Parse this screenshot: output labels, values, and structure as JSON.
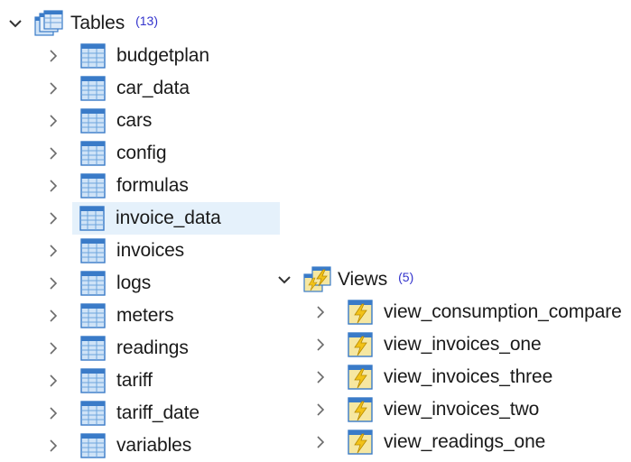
{
  "tables": {
    "label": "Tables",
    "count": "(13)",
    "items": [
      {
        "label": "budgetplan"
      },
      {
        "label": "car_data"
      },
      {
        "label": "cars"
      },
      {
        "label": "config"
      },
      {
        "label": "formulas"
      },
      {
        "label": "invoice_data",
        "hovered": true
      },
      {
        "label": "invoices"
      },
      {
        "label": "logs"
      },
      {
        "label": "meters"
      },
      {
        "label": "readings"
      },
      {
        "label": "tariff"
      },
      {
        "label": "tariff_date"
      },
      {
        "label": "variables"
      }
    ]
  },
  "views": {
    "label": "Views",
    "count": "(5)",
    "items": [
      {
        "label": "view_consumption_compare"
      },
      {
        "label": "view_invoices_one"
      },
      {
        "label": "view_invoices_three"
      },
      {
        "label": "view_invoices_two"
      },
      {
        "label": "view_readings_one"
      }
    ]
  },
  "colors": {
    "count_text": "#3333cc",
    "hover_bg": "#e5f1fb",
    "table_icon_blue": "#3a7bc8",
    "view_icon_yellow": "#f2c218"
  },
  "icons": {
    "expanded": "chevron-down-icon",
    "collapsed": "chevron-right-icon",
    "folder_tables": "tables-folder-icon",
    "folder_views": "views-folder-icon",
    "table": "table-icon",
    "view": "view-icon"
  }
}
